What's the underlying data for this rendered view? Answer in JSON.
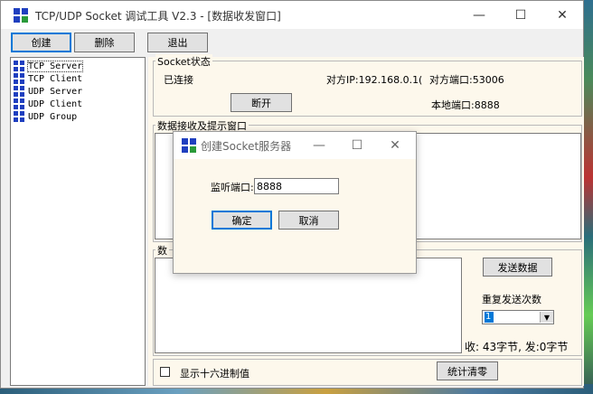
{
  "window": {
    "title": "TCP/UDP Socket 调试工具 V2.3  - [数据收发窗口]",
    "minimize": "—",
    "maximize": "☐",
    "close": "✕"
  },
  "toolbar": {
    "create_label": "创建",
    "delete_label": "删除",
    "exit_label": "退出"
  },
  "tree": {
    "items": [
      {
        "label": "TCP Server",
        "icon": "grid-icon"
      },
      {
        "label": "TCP Client",
        "icon": "grid-icon"
      },
      {
        "label": "UDP Server",
        "icon": "grid-icon"
      },
      {
        "label": "UDP Client",
        "icon": "grid-icon"
      },
      {
        "label": "UDP Group",
        "icon": "grid-icon"
      }
    ]
  },
  "socket_status": {
    "title": "Socket状态",
    "state": "已连接",
    "remote_ip": "对方IP:192.168.0.1(",
    "remote_port": "对方端口:53006",
    "disconnect_label": "断开",
    "local_port": "本地端口:8888"
  },
  "receive": {
    "title": "数据接收及提示窗口"
  },
  "send": {
    "title_fragment": "数",
    "send_label": "发送数据",
    "repeat_label": "重复发送次数",
    "repeat_value": "1",
    "stats": "收: 43字节, 发:0字节",
    "hex_label": "显示十六进制值",
    "clear_stats_label": "统计清零"
  },
  "dialog": {
    "title": "创建Socket服务器",
    "listen_port_label": "监听端口:",
    "listen_port_value": "8888",
    "ok_label": "确定",
    "cancel_label": "取消",
    "minimize": "—",
    "maximize": "☐",
    "close": "✕"
  },
  "colors": {
    "panel_bg": "#fdf8ec",
    "accent": "#0078d7",
    "icon_blue": "#1f3fbf"
  }
}
